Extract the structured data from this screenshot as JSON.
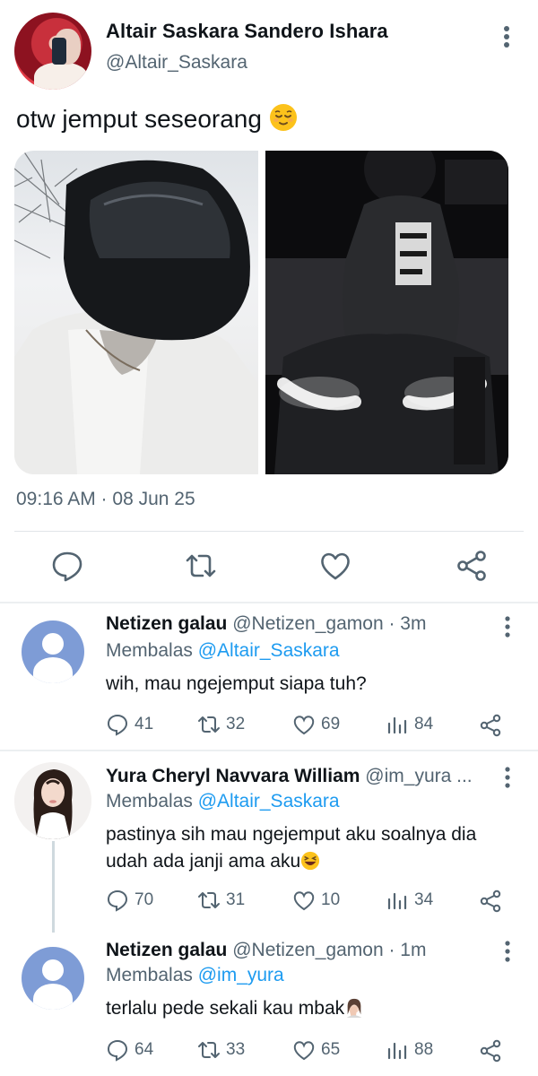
{
  "main_tweet": {
    "name": "Altair Saskara Sandero Ishara",
    "handle": "@Altair_Saskara",
    "text": "otw jemput seseorang",
    "timestamp": "09:16 AM · 08 Jun 25",
    "emoji": "relieved-face-icon"
  },
  "replies": [
    {
      "name": "Netizen galau",
      "handle_time": "@Netizen_gamon · 3m",
      "replying_label": "Membalas",
      "replying_to": "@Altair_Saskara",
      "text": "wih, mau ngejemput siapa tuh?",
      "stats": {
        "replies": "41",
        "retweets": "32",
        "likes": "69",
        "views": "84"
      }
    },
    {
      "name": "Yura Cheryl Navvara William",
      "handle_time": "@im_yura ...",
      "replying_label": "Membalas",
      "replying_to": "@Altair_Saskara",
      "text_line1": "pastinya sih mau ngejemput aku soalnya dia",
      "text_line2": "udah ada janji ama aku",
      "stats": {
        "replies": "70",
        "retweets": "31",
        "likes": "10",
        "views": "34"
      }
    },
    {
      "name": "Netizen galau",
      "handle_time": "@Netizen_gamon · 1m",
      "replying_label": "Membalas",
      "replying_to": "@im_yura",
      "text": "terlalu pede sekali kau mbak",
      "stats": {
        "replies": "64",
        "retweets": "33",
        "likes": "65",
        "views": "88"
      }
    }
  ],
  "colors": {
    "link": "#1d9bf0",
    "secondary": "#536471",
    "default_avatar": "#7e9cd6"
  }
}
